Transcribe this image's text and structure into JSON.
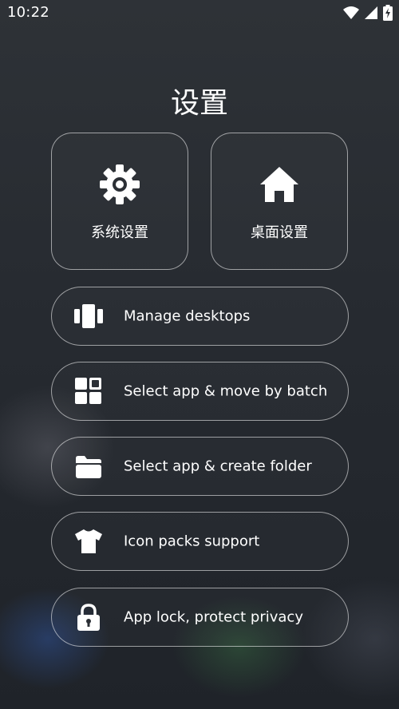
{
  "status_bar": {
    "time": "10:22",
    "icons": [
      "wifi-icon",
      "signal-icon",
      "battery-icon"
    ]
  },
  "page": {
    "title": "设置"
  },
  "tiles": [
    {
      "label": "系统设置",
      "icon": "gear-icon"
    },
    {
      "label": "桌面设置",
      "icon": "home-icon"
    }
  ],
  "options": [
    {
      "label": "Manage desktops",
      "icon": "desktops-icon"
    },
    {
      "label": "Select app & move by batch",
      "icon": "grid-icon"
    },
    {
      "label": "Select app & create folder",
      "icon": "folder-icon"
    },
    {
      "label": "Icon packs support",
      "icon": "shirt-icon"
    },
    {
      "label": "App lock, protect privacy",
      "icon": "lock-icon"
    }
  ],
  "colors": {
    "text": "#ffffff",
    "border": "#8c8f93",
    "background": "#272b31"
  }
}
